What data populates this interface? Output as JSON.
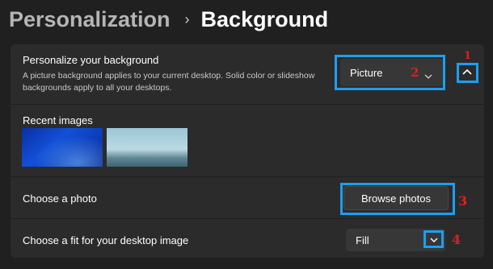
{
  "breadcrumb": {
    "parent": "Personalization",
    "separator": "›",
    "current": "Background"
  },
  "personalize": {
    "title": "Personalize your background",
    "description": "A picture background applies to your current desktop. Solid color or slideshow backgrounds apply to all your desktops.",
    "dropdown_value": "Picture"
  },
  "recent": {
    "label": "Recent images"
  },
  "choose_photo": {
    "label": "Choose a photo",
    "button": "Browse photos"
  },
  "fit": {
    "label": "Choose a fit for your desktop image",
    "value": "Fill"
  },
  "annotations": [
    "1",
    "2",
    "3",
    "4"
  ],
  "colors": {
    "highlight": "#1b9ff0",
    "annotation": "#e0201c",
    "panel": "#2b2b2b",
    "background": "#202020"
  },
  "icons": {
    "dropdown": "chevron-down-icon",
    "expand": "chevron-up-icon",
    "fit": "chevron-down-icon"
  }
}
